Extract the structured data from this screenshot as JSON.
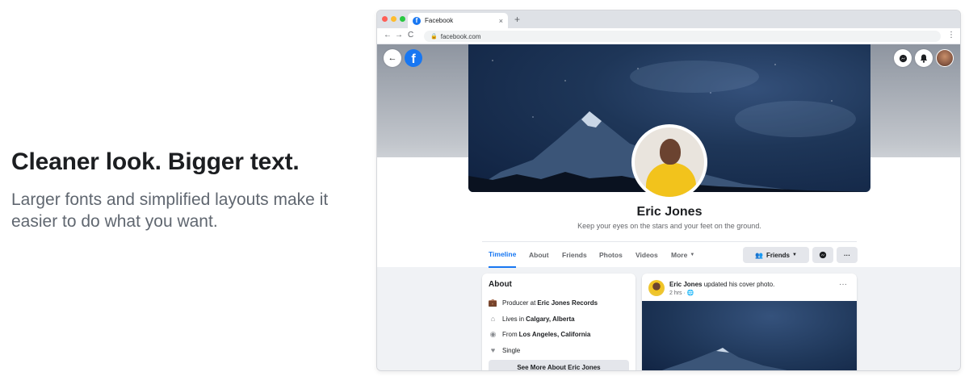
{
  "promo": {
    "headline": "Cleaner look. Bigger text.",
    "subtext": "Larger fonts and simplified layouts make it easier to do what you want."
  },
  "browser": {
    "tab_title": "Facebook",
    "tab_close": "×",
    "new_tab": "+",
    "url": "facebook.com",
    "nav": {
      "back": "←",
      "forward": "→",
      "reload": "C"
    },
    "menu": "⋮"
  },
  "header": {
    "logo_letter": "f"
  },
  "profile": {
    "name": "Eric Jones",
    "bio": "Keep your eyes on the stars and your feet on the ground."
  },
  "tabs": [
    {
      "label": "Timeline"
    },
    {
      "label": "About"
    },
    {
      "label": "Friends"
    },
    {
      "label": "Photos"
    },
    {
      "label": "Videos"
    },
    {
      "label": "More"
    }
  ],
  "actions": {
    "friends_label": "Friends",
    "more_label": "···"
  },
  "about": {
    "title": "About",
    "items": [
      {
        "prefix": "Producer at",
        "strong": "Eric Jones Records",
        "suffix": ""
      },
      {
        "prefix": "Lives in",
        "strong": "Calgary, Alberta",
        "suffix": ""
      },
      {
        "prefix": "From",
        "strong": "Los Angeles, California",
        "suffix": ""
      },
      {
        "prefix": "Single",
        "strong": "",
        "suffix": ""
      }
    ],
    "see_more": "See More About Eric Jones"
  },
  "post": {
    "author": "Eric Jones",
    "action": "updated his cover photo.",
    "time": "2 hrs",
    "more": "···"
  },
  "colors": {
    "accent": "#1877f2",
    "gray_button": "#e4e6eb",
    "page_bg": "#f0f2f5"
  }
}
